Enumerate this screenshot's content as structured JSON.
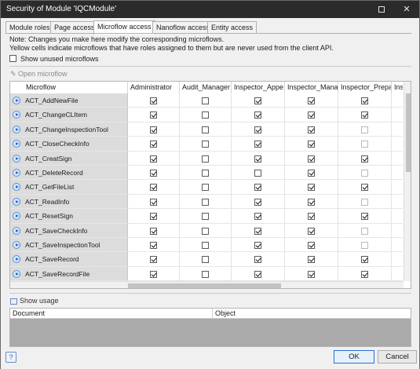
{
  "window": {
    "title": "Security of Module 'IQCModule'",
    "maximize_glyph": "",
    "close_glyph": "✕"
  },
  "tabs": [
    "Module roles",
    "Page access",
    "Microflow access",
    "Nanoflow access",
    "Entity access"
  ],
  "active_tab": 2,
  "notes": {
    "line1": "Note: Changes you make here modify the corresponding microflows.",
    "line2": "Yellow cells indicate microflows that have roles assigned to them but are never used from the client API."
  },
  "show_unused": {
    "label": "Show unused microflows",
    "checked": false
  },
  "toolbar": {
    "open_microflow": "Open microflow",
    "pencil_icon": "pencil-icon"
  },
  "grid": {
    "columns": [
      "Microflow",
      "Administrator",
      "Audit_Manager",
      "Inspector_Appe",
      "Inspector_Mana",
      "Inspector_Prepa",
      "Insp"
    ],
    "rows": [
      {
        "name": "ACT_AddNewFile",
        "checks": [
          1,
          0,
          1,
          1,
          1
        ]
      },
      {
        "name": "ACT_ChangeCLItem",
        "checks": [
          1,
          0,
          1,
          1,
          1
        ]
      },
      {
        "name": "ACT_ChangeInspectionTool",
        "checks": [
          1,
          0,
          1,
          1,
          0
        ]
      },
      {
        "name": "ACT_CloseCheckInfo",
        "checks": [
          1,
          0,
          1,
          1,
          0
        ]
      },
      {
        "name": "ACT_CreatSign",
        "checks": [
          1,
          0,
          1,
          1,
          1
        ]
      },
      {
        "name": "ACT_DeleteRecord",
        "checks": [
          1,
          0,
          0,
          1,
          0
        ]
      },
      {
        "name": "ACT_GetFileList",
        "checks": [
          1,
          0,
          1,
          1,
          1
        ]
      },
      {
        "name": "ACT_ReadInfo",
        "checks": [
          1,
          0,
          1,
          1,
          0
        ]
      },
      {
        "name": "ACT_ResetSign",
        "checks": [
          1,
          0,
          1,
          1,
          1
        ]
      },
      {
        "name": "ACT_SaveCheckInfo",
        "checks": [
          1,
          0,
          1,
          1,
          0
        ]
      },
      {
        "name": "ACT_SaveInspectionTool",
        "checks": [
          1,
          0,
          1,
          1,
          0
        ]
      },
      {
        "name": "ACT_SaveRecord",
        "checks": [
          1,
          0,
          1,
          1,
          1
        ]
      },
      {
        "name": "ACT_SaveRecordFile",
        "checks": [
          1,
          0,
          1,
          1,
          1
        ]
      }
    ]
  },
  "usage": {
    "label": "Show usage",
    "col_document": "Document",
    "col_object": "Object"
  },
  "footer": {
    "help": "?",
    "ok": "OK",
    "cancel": "Cancel"
  },
  "colors": {
    "titlebar": "#2b2b2b",
    "name_col_bg": "#dcdcdc",
    "ok_border": "#2b6fd6"
  }
}
